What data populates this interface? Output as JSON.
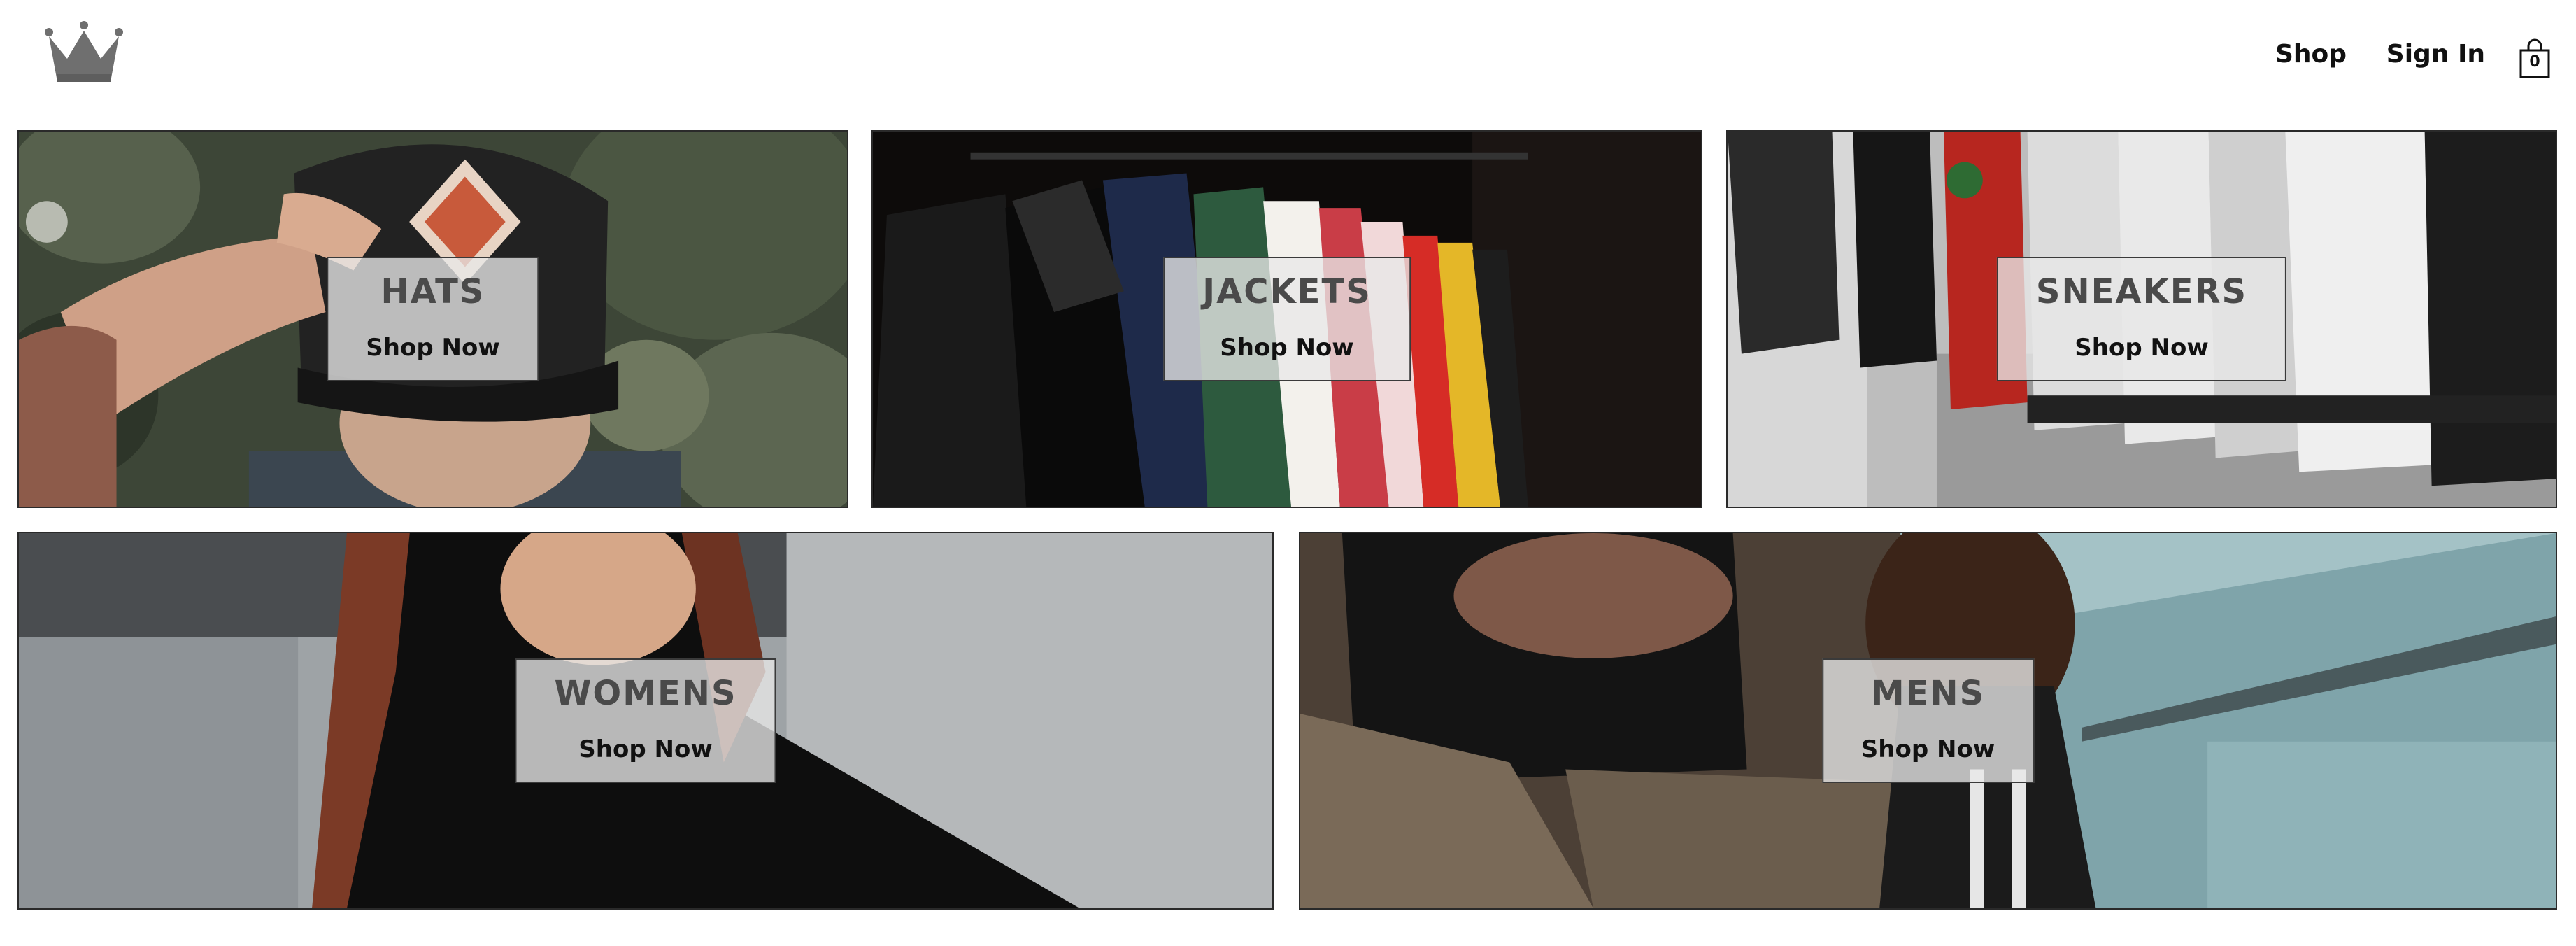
{
  "header": {
    "logo": {
      "icon": "crown-icon"
    },
    "nav": {
      "shop_label": "Shop",
      "signin_label": "Sign In"
    },
    "cart": {
      "icon": "shopping-bag-icon",
      "count": "0"
    }
  },
  "categories": [
    {
      "title": "HATS",
      "cta": "Shop Now"
    },
    {
      "title": "JACKETS",
      "cta": "Shop Now"
    },
    {
      "title": "SNEAKERS",
      "cta": "Shop Now"
    },
    {
      "title": "WOMENS",
      "cta": "Shop Now"
    },
    {
      "title": "MENS",
      "cta": "Shop Now"
    }
  ],
  "colors": {
    "background": "#ffffff",
    "label_box": "#e8e8e8",
    "title_text": "#4a4a4a",
    "tile_border": "#2a2a2a"
  }
}
